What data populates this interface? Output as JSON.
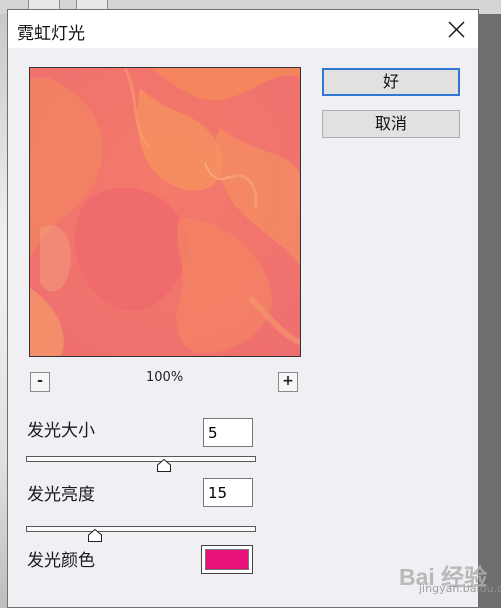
{
  "dialog": {
    "title": "霓虹灯光",
    "ok_label": "好",
    "cancel_label": "取消"
  },
  "preview": {
    "zoom_label": "100%",
    "zoom_out_label": "-",
    "zoom_in_label": "+"
  },
  "controls": {
    "glow_size": {
      "label": "发光大小",
      "value": "5",
      "level": 0.6
    },
    "glow_brightness": {
      "label": "发光亮度",
      "value": "15",
      "level": 0.3
    },
    "glow_color": {
      "label": "发光颜色",
      "value": "#e8117a"
    }
  },
  "watermark": {
    "brand": "Bai 经验",
    "url": "jingyan.baidu.com"
  },
  "colors": {
    "dialog_bg": "#f0eff4",
    "accent": "#2f77d1",
    "preview_base": "#f27c6c"
  },
  "icons": {
    "close": "close-icon",
    "slider_thumb": "slider-thumb-icon"
  }
}
